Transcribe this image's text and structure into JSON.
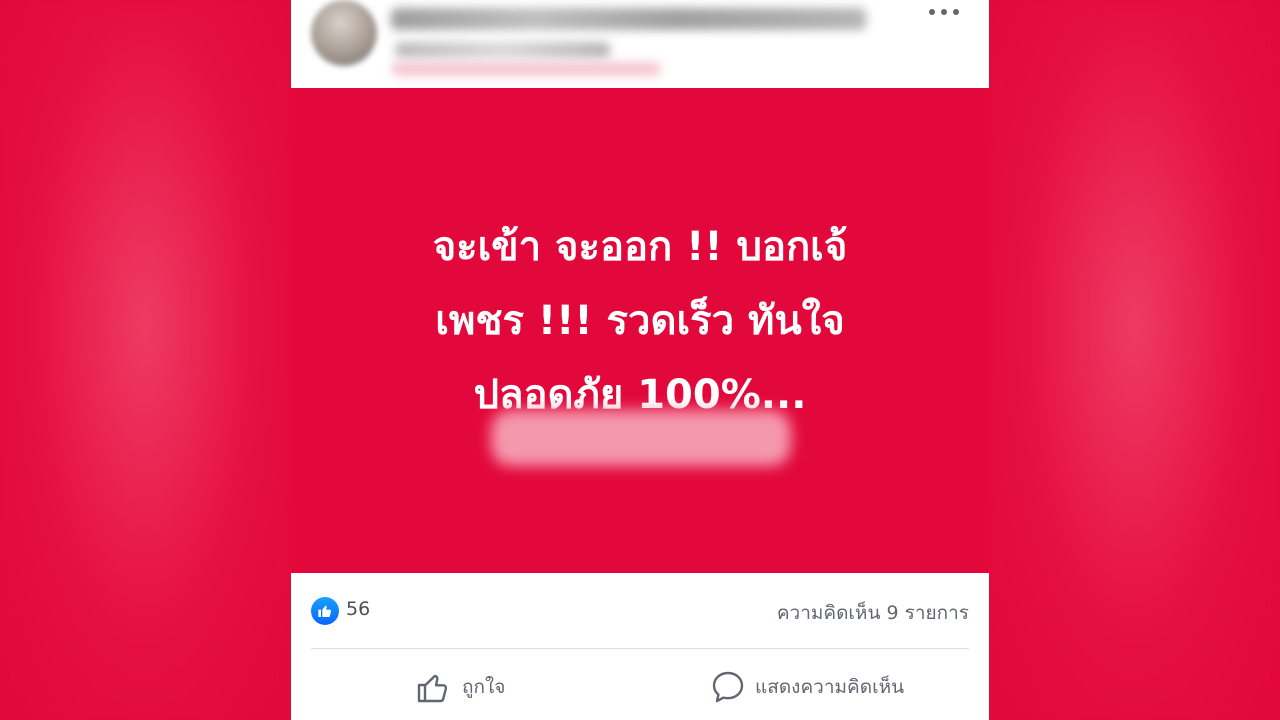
{
  "post": {
    "text_lines": [
      "จะเข้า  จะออก !!  บอกเจ้",
      "เพชร !!! รวดเร็ว ทันใจ",
      "ปลอดภัย 100%..."
    ],
    "reactions": {
      "like_count": "56",
      "comments_label": "ความคิดเห็น 9 รายการ"
    },
    "actions": {
      "like_label": "ถูกใจ",
      "comment_label": "แสดงความคิดเห็น"
    }
  },
  "colors": {
    "background": "#e3093b",
    "post_image_bg": "#e2083b",
    "like_blue": "#0866ff",
    "text_gray": "#606770"
  },
  "icons": [
    "more-dots-icon",
    "like-badge-icon",
    "thumbs-up-icon",
    "comment-bubble-icon"
  ]
}
